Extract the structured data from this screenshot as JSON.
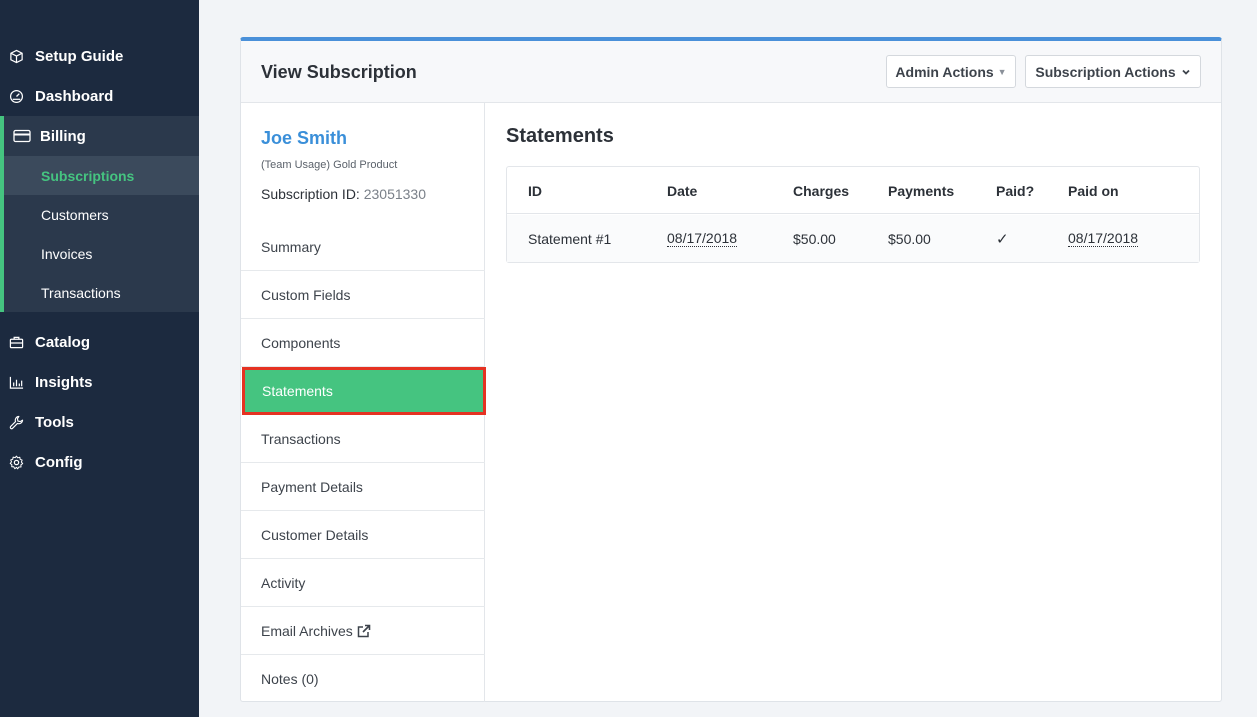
{
  "sidebar": {
    "items": [
      {
        "label": "Setup Guide",
        "icon": "cube-icon"
      },
      {
        "label": "Dashboard",
        "icon": "gauge-icon"
      },
      {
        "label": "Billing",
        "icon": "credit-card-icon"
      },
      {
        "label": "Catalog",
        "icon": "briefcase-icon"
      },
      {
        "label": "Insights",
        "icon": "bar-chart-icon"
      },
      {
        "label": "Tools",
        "icon": "wrench-icon"
      },
      {
        "label": "Config",
        "icon": "gear-icon"
      }
    ],
    "billing_sub": [
      "Subscriptions",
      "Customers",
      "Invoices",
      "Transactions"
    ],
    "active_sub": "Subscriptions"
  },
  "header": {
    "title": "View Subscription",
    "admin_actions": "Admin Actions",
    "subscription_actions": "Subscription Actions"
  },
  "customer": {
    "name": "Joe Smith",
    "product": "(Team Usage) Gold Product",
    "sub_id_label": "Subscription ID:",
    "sub_id_value": "23051330"
  },
  "menu": [
    "Summary",
    "Custom Fields",
    "Components",
    "Statements",
    "Transactions",
    "Payment Details",
    "Customer Details",
    "Activity",
    "Email Archives",
    "Notes (0)"
  ],
  "active_menu": "Statements",
  "statements": {
    "title": "Statements",
    "columns": [
      "ID",
      "Date",
      "Charges",
      "Payments",
      "Paid?",
      "Paid on"
    ],
    "rows": [
      {
        "id": "Statement #1",
        "date": "08/17/2018",
        "charges": "$50.00",
        "payments": "$50.00",
        "paid": "✓",
        "paid_on": "08/17/2018"
      }
    ]
  },
  "colors": {
    "sidebar_bg": "#1c2a3f",
    "accent_green": "#45c480",
    "link_blue": "#3a8fd9",
    "panel_top_border": "#4a90d9",
    "highlight_red": "#e53222"
  }
}
